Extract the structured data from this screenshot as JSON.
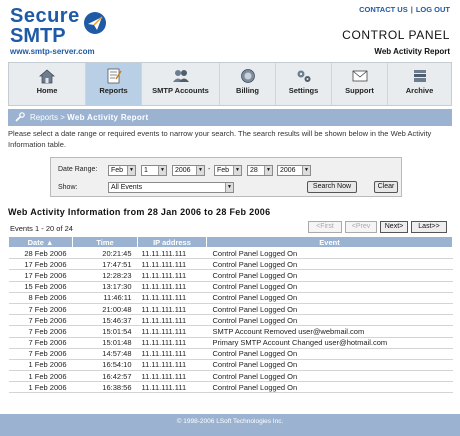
{
  "brand": {
    "line1": "Secure",
    "line2": "SMTP",
    "url": "www.smtp-server.com"
  },
  "toplinks": {
    "contact": "CONTACT US",
    "logout": "LOG OUT",
    "sep": "|"
  },
  "header": {
    "title": "CONTROL PANEL",
    "subtitle": "Web Activity Report"
  },
  "nav": [
    {
      "label": "Home",
      "icon": "home-icon"
    },
    {
      "label": "Reports",
      "icon": "reports-icon",
      "active": true
    },
    {
      "label": "SMTP Accounts",
      "icon": "users-icon"
    },
    {
      "label": "Billing",
      "icon": "billing-icon"
    },
    {
      "label": "Settings",
      "icon": "settings-icon"
    },
    {
      "label": "Support",
      "icon": "support-icon"
    },
    {
      "label": "Archive",
      "icon": "archive-icon"
    }
  ],
  "breadcrumb": {
    "parent": "Reports",
    "sep": " > ",
    "current": "Web Activity Report"
  },
  "intro": "Please select a date range or required events to narrow your search. The search results will be shown below in the Web Activity Information table.",
  "filter": {
    "date_label": "Date Range:",
    "from_month": "Feb",
    "from_day": "1",
    "from_year": "2006",
    "dash": "-",
    "to_month": "Feb",
    "to_day": "28",
    "to_year": "2006",
    "show_label": "Show:",
    "show_value": "All Events",
    "search_btn": "Search Now",
    "clear_btn": "Clear"
  },
  "section_title": "Web Activity Information from 28 Jan 2006 to 28 Feb 2006",
  "count_text": "Events 1 - 20 of 24",
  "pager": {
    "first": "<First",
    "prev": "<Prev",
    "next": "Next>",
    "last": "Last>>"
  },
  "table": {
    "headers": {
      "date": "Date ▲",
      "time": "Time",
      "ip": "IP address",
      "event": "Event"
    },
    "rows": [
      {
        "date": "28 Feb 2006",
        "time": "20:21:45",
        "ip": "11.11.111.111",
        "event": "Control Panel Logged On"
      },
      {
        "date": "17 Feb 2006",
        "time": "17:47:51",
        "ip": "11.11.111.111",
        "event": "Control Panel Logged On"
      },
      {
        "date": "17 Feb 2006",
        "time": "12:28:23",
        "ip": "11.11.111.111",
        "event": "Control Panel Logged On"
      },
      {
        "date": "15 Feb 2006",
        "time": "13:17:30",
        "ip": "11.11.111.111",
        "event": "Control Panel Logged On"
      },
      {
        "date": "8 Feb 2006",
        "time": "11:46:11",
        "ip": "11.11.111.111",
        "event": "Control Panel Logged On"
      },
      {
        "date": "7 Feb 2006",
        "time": "21:00:48",
        "ip": "11.11.111.111",
        "event": "Control Panel Logged On"
      },
      {
        "date": "7 Feb 2006",
        "time": "15:46:37",
        "ip": "11.11.111.111",
        "event": "Control Panel Logged On"
      },
      {
        "date": "7 Feb 2006",
        "time": "15:01:54",
        "ip": "11.11.111.111",
        "event": "SMTP Account Removed user@webmail.com"
      },
      {
        "date": "7 Feb 2006",
        "time": "15:01:48",
        "ip": "11.11.111.111",
        "event": "Primary SMTP Account Changed user@hotmail.com"
      },
      {
        "date": "7 Feb 2006",
        "time": "14:57:48",
        "ip": "11.11.111.111",
        "event": "Control Panel Logged On"
      },
      {
        "date": "1 Feb 2006",
        "time": "16:54:10",
        "ip": "11.11.111.111",
        "event": "Control Panel Logged On"
      },
      {
        "date": "1 Feb 2006",
        "time": "16:42:57",
        "ip": "11.11.111.111",
        "event": "Control Panel Logged On"
      },
      {
        "date": "1 Feb 2006",
        "time": "16:38:56",
        "ip": "11.11.111.111",
        "event": "Control Panel Logged On"
      }
    ]
  },
  "footer": "© 1998-2006 LSoft Technologies Inc.",
  "colors": {
    "brand": "#1f5aa6",
    "bar": "#9bb3d1",
    "active_tab": "#b8cfe6"
  }
}
